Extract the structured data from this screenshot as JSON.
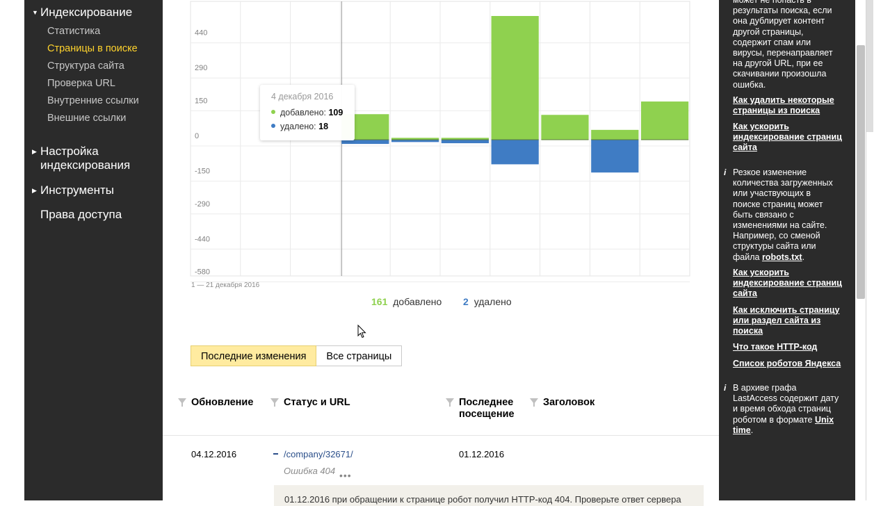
{
  "sidebar": {
    "sections": [
      {
        "title": "Индексирование",
        "expanded": true
      },
      {
        "title": "Настройка индексирования",
        "expanded": false
      },
      {
        "title": "Инструменты",
        "expanded": false
      },
      {
        "title": "Права доступа"
      }
    ],
    "indexing_items": [
      {
        "label": "Статистика",
        "active": false
      },
      {
        "label": "Страницы в поиске",
        "active": true
      },
      {
        "label": "Структура сайта",
        "active": false
      },
      {
        "label": "Проверка URL",
        "active": false
      },
      {
        "label": "Внутренние ссылки",
        "active": false
      },
      {
        "label": "Внешние ссылки",
        "active": false
      }
    ]
  },
  "chart_data": {
    "type": "bar",
    "y_ticks": [
      "440",
      "290",
      "150",
      "0",
      "-150",
      "-290",
      "-440",
      "-580"
    ],
    "ylim": [
      -620,
      500
    ],
    "range_label": "1 — 21 декабря 2016",
    "colors": {
      "added": "#8fd14f",
      "removed": "#3f7cc4"
    },
    "series": [
      {
        "key": "added",
        "values": [
          0,
          0,
          0,
          109,
          8,
          8,
          528,
          106,
          42,
          163
        ]
      },
      {
        "key": "removed",
        "values": [
          0,
          0,
          0,
          18,
          10,
          15,
          105,
          0,
          140,
          0
        ]
      }
    ],
    "grid": true,
    "tooltip": {
      "date": "4 декабря 2016",
      "added_label": "добавлено:",
      "added_value": "109",
      "removed_label": "удалено:",
      "removed_value": "18"
    },
    "totals": {
      "added": "161",
      "added_label": "добавлено",
      "removed": "2",
      "removed_label": "удалено"
    }
  },
  "tabs": [
    {
      "label": "Последние изменения",
      "active": true
    },
    {
      "label": "Все страницы",
      "active": false
    }
  ],
  "table": {
    "headers": {
      "updated": "Обновление",
      "status_url": "Статус и URL",
      "last_visit_1": "Последнее",
      "last_visit_2": "посещение",
      "title": "Заголовок"
    },
    "rows": [
      {
        "updated": "04.12.2016",
        "url": "/company/32671/",
        "status": "Ошибка 404",
        "last_visit": "01.12.2016",
        "title": ""
      }
    ],
    "expanded_text": "01.12.2016 при обращении к странице робот получил HTTP-код 404. Проверьте ответ сервера"
  },
  "right_panel": {
    "intro_lines": [
      "может не попасть в",
      "результаты поиска, если",
      "она дублирует контент",
      "другой страницы,",
      "содержит спам или",
      "вирусы, перенаправляет",
      "на другой URL, при ее",
      "скачивании произошла",
      "ошибка."
    ],
    "links1": [
      [
        "Как удалить некоторые",
        "страницы из поиска"
      ],
      [
        "Как ускорить",
        "индексирование страниц",
        "сайта"
      ]
    ],
    "info_icon": "i",
    "para2_lines": [
      "Резкое изменение",
      "количества загруженных",
      "или участвующих в",
      "поиске страниц может",
      "быть связано с",
      "изменениями на сайте.",
      "Например, со сменой",
      "структуры сайта или"
    ],
    "para2_last_prefix": "файла ",
    "para2_link": "robots.txt",
    "para2_suffix": ".",
    "links2": [
      [
        "Как ускорить",
        "индексирование страниц",
        "сайта"
      ],
      [
        "Как исключить страницу",
        "или раздел сайта из",
        "поиска"
      ],
      [
        "Что такое HTTP-код"
      ],
      [
        "Список роботов Яндекса"
      ]
    ],
    "para3_lines": [
      "В архиве графа",
      "LastAccess содержит дату",
      "и время обхода страниц"
    ],
    "para3_last_prefix": "роботом в формате ",
    "para3_link_1": "Unix",
    "para3_link_2": "time",
    "para3_suffix": "."
  }
}
